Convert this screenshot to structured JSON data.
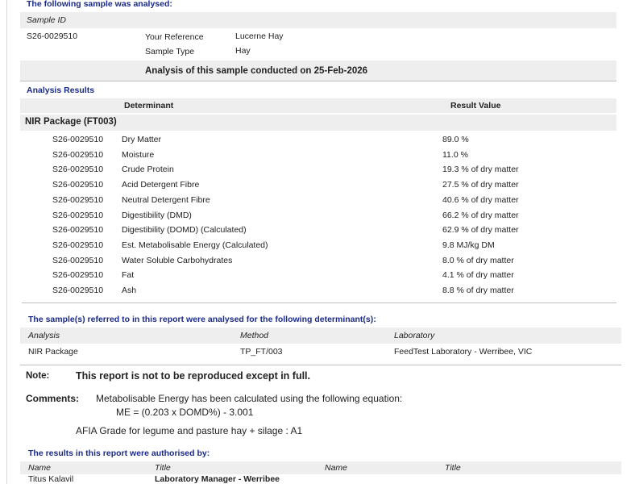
{
  "header": {
    "heading": "The following sample was analysed:",
    "sample_id_label": "Sample ID",
    "sample_id": "S26-0029510",
    "your_reference_label": "Your Reference",
    "your_reference": "Lucerne Hay",
    "sample_type_label": "Sample Type",
    "sample_type": "Hay",
    "conducted_on": "Analysis of this sample conducted on 25-Feb-2026"
  },
  "results": {
    "heading": "Analysis Results",
    "col_determinant": "Determinant",
    "col_result": "Result Value",
    "package_title": "NIR Package  (FT003)",
    "rows": [
      {
        "sample": "S26-0029510",
        "determinant": "Dry Matter",
        "value": "89.0 %"
      },
      {
        "sample": "S26-0029510",
        "determinant": "Moisture",
        "value": "11.0 %"
      },
      {
        "sample": "S26-0029510",
        "determinant": "Crude Protein",
        "value": "19.3 % of dry matter"
      },
      {
        "sample": "S26-0029510",
        "determinant": "Acid Detergent Fibre",
        "value": "27.5 % of dry matter"
      },
      {
        "sample": "S26-0029510",
        "determinant": "Neutral Detergent Fibre",
        "value": "40.6 % of dry matter"
      },
      {
        "sample": "S26-0029510",
        "determinant": "Digestibility (DMD)",
        "value": "66.2 % of dry matter"
      },
      {
        "sample": "S26-0029510",
        "determinant": "Digestibility (DOMD) (Calculated)",
        "value": "62.9 % of dry matter"
      },
      {
        "sample": "S26-0029510",
        "determinant": "Est. Metabolisable Energy (Calculated)",
        "value": "9.8 MJ/kg DM"
      },
      {
        "sample": "S26-0029510",
        "determinant": "Water Soluble Carbohydrates",
        "value": "8.0 % of dry matter"
      },
      {
        "sample": "S26-0029510",
        "determinant": "Fat",
        "value": "4.1 % of dry matter"
      },
      {
        "sample": "S26-0029510",
        "determinant": "Ash",
        "value": "8.8 % of dry matter"
      }
    ]
  },
  "determinants": {
    "heading": "The sample(s) referred to in this report were analysed for the following determinant(s):",
    "col_analysis": "Analysis",
    "col_method": "Method",
    "col_laboratory": "Laboratory",
    "analysis": "NIR Package",
    "method": "TP_FT/003",
    "laboratory": "FeedTest Laboratory - Werribee, VIC"
  },
  "note": {
    "label": "Note:",
    "text": "This report is not to be reproduced except in full."
  },
  "comments": {
    "label": "Comments:",
    "line1": "Metabolisable Energy has been calculated using the following equation:",
    "line2": "ME = (0.203 x DOMD%) - 3.001",
    "line3": "AFIA Grade for legume and pasture hay + silage : A1"
  },
  "authorised": {
    "heading": "The results in this report were authorised by:",
    "col_name1": "Name",
    "col_title1": "Title",
    "col_name2": "Name",
    "col_title2": "Title",
    "person_name": "Titus Kalavil",
    "person_title": "Laboratory Manager - Werribee"
  }
}
